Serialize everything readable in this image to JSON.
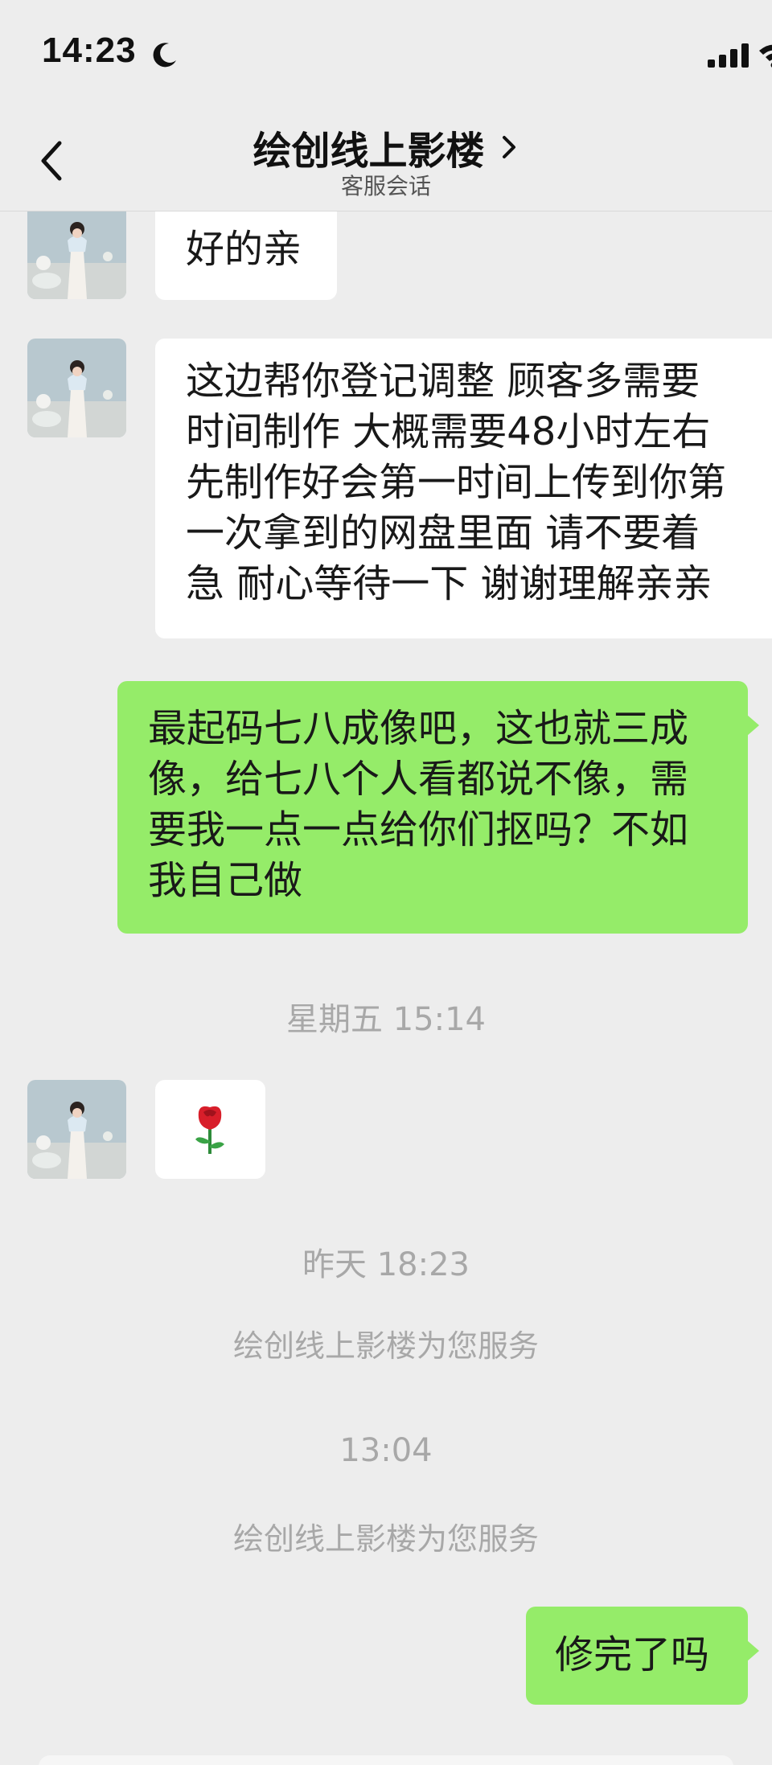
{
  "status_bar": {
    "time": "14:23"
  },
  "header": {
    "title": "绘创线上影楼",
    "subtitle": "客服会话"
  },
  "messages": [
    {
      "from": "shop",
      "text": "好的亲"
    },
    {
      "from": "shop",
      "lines": [
        "这边帮你登记调整 顾客多需要",
        "时间制作 大概需要48小时左右",
        "先制作好会第一时间上传到你第",
        "一次拿到的网盘里面 请不要着",
        "急 耐心等待一下 谢谢理解亲亲"
      ]
    },
    {
      "from": "me",
      "lines": [
        "最起码七八成像吧，这也就三成",
        "像，给七八个人看都说不像，需",
        "要我一点一点给你们抠吗？不如",
        "我自己做"
      ]
    },
    {
      "type": "timestamp",
      "text": "星期五 15:14"
    },
    {
      "from": "shop",
      "text": "🌹"
    },
    {
      "type": "timestamp",
      "text": "昨天 18:23"
    },
    {
      "type": "system",
      "text": "绘创线上影楼为您服务"
    },
    {
      "type": "timestamp",
      "text": "13:04"
    },
    {
      "type": "system",
      "text": "绘创线上影楼为您服务"
    },
    {
      "from": "me",
      "text": "修完了吗"
    }
  ],
  "colors": {
    "background": "#ededed",
    "incoming_bubble": "#ffffff",
    "outgoing_bubble": "#95ec69",
    "meta_text": "#a8a8a8"
  },
  "icons": {
    "back": "chevron-left-icon",
    "title_more": "chevron-right-icon",
    "moon": "moon-icon",
    "signal": "signal-icon",
    "wifi": "wifi-icon"
  }
}
